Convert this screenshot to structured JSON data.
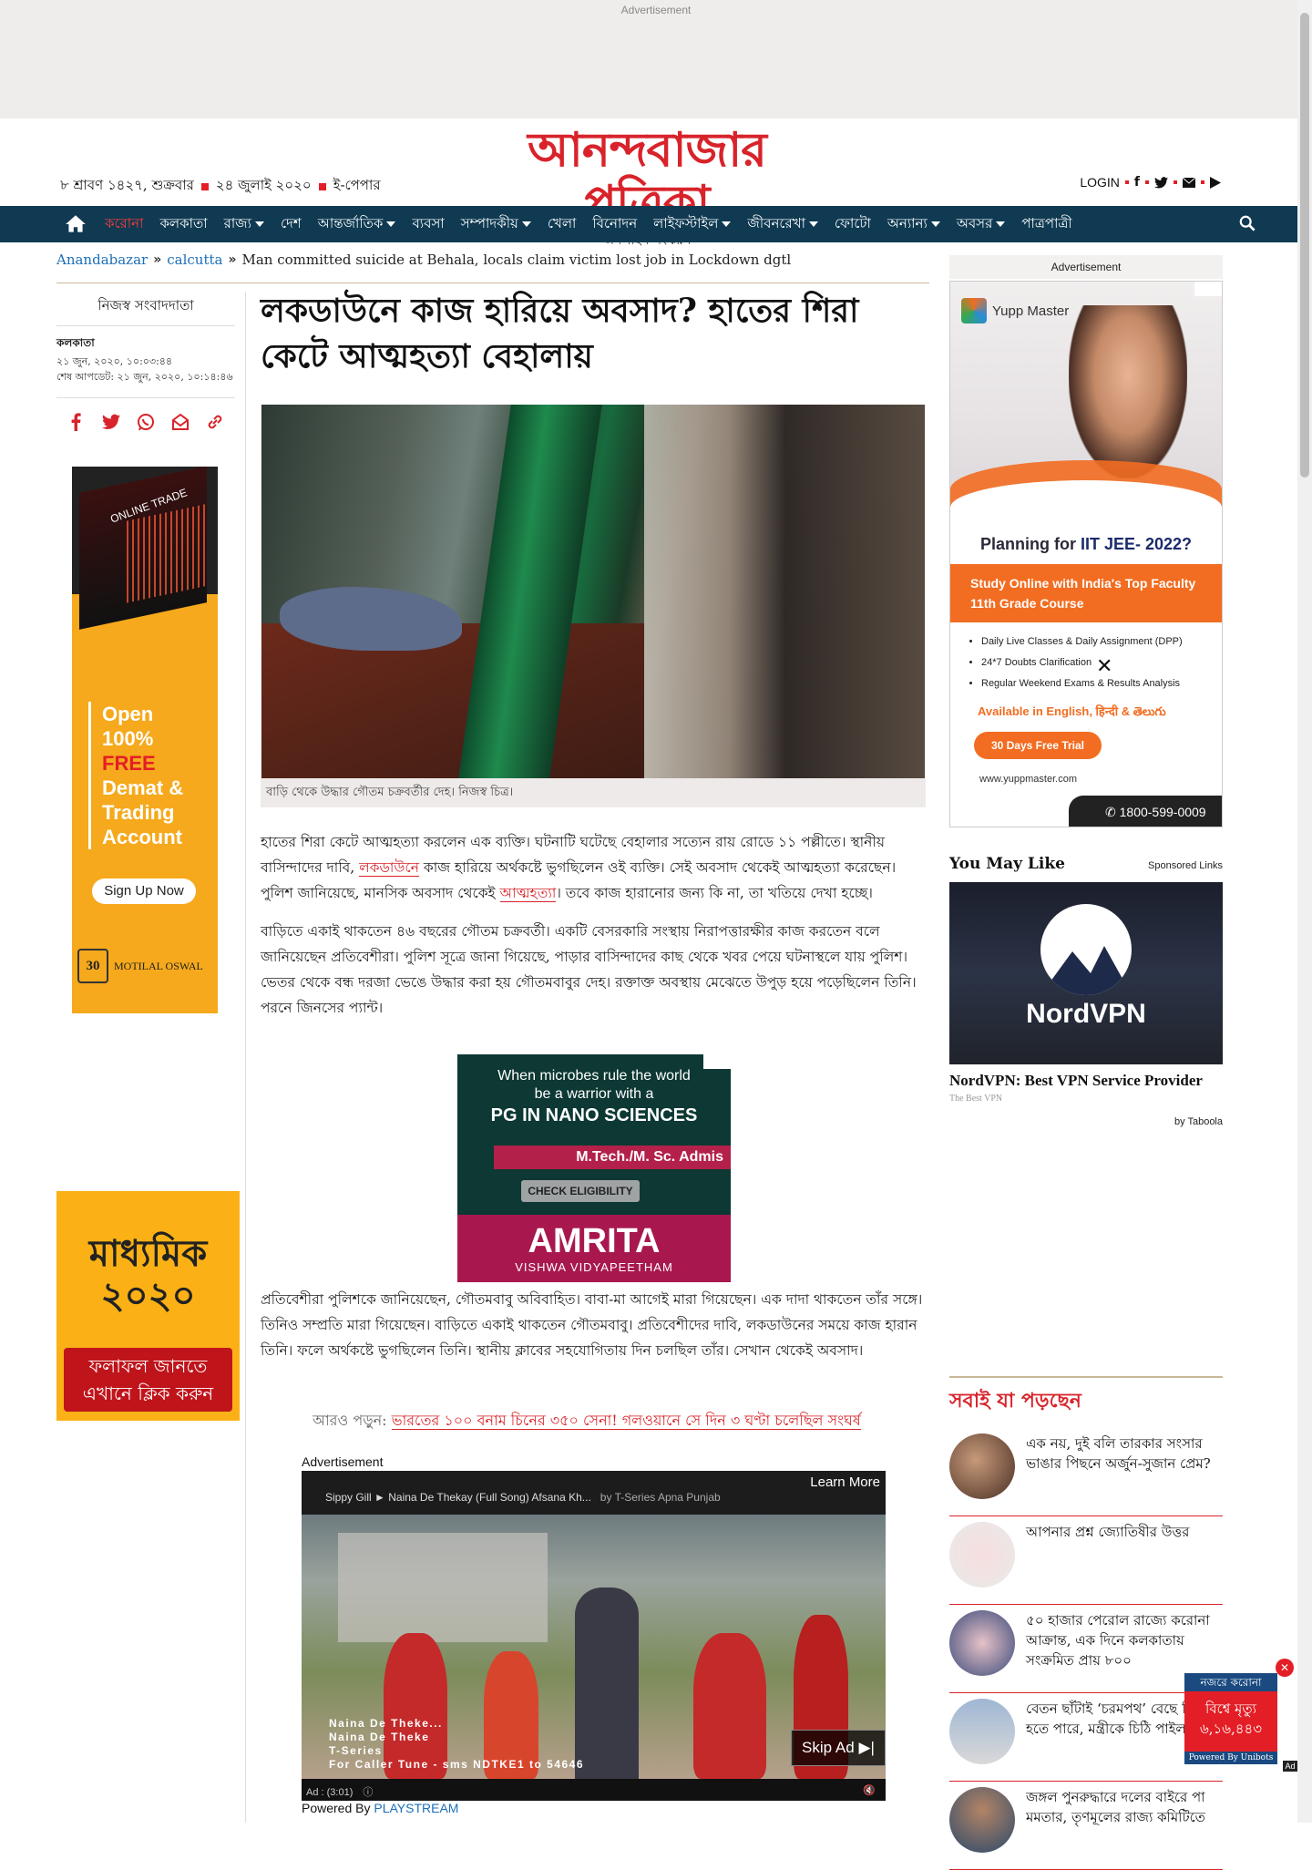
{
  "ads": {
    "top_label": "Advertisement",
    "right_label": "Advertisement",
    "video_label": "Advertisement"
  },
  "header": {
    "date_bn": "৮ শ্রাবণ ১৪২৭, শুক্রবার",
    "date_en_bn": "২৪ জুলাই ২০২০",
    "epaper": "ই-পেপার",
    "logo": "আনন্দবাজার পত্রিকা",
    "logo_sub": "অনলাইন সংস্করণ",
    "login": "LOGIN"
  },
  "nav": {
    "items": [
      {
        "label": "করোনা",
        "red": true
      },
      {
        "label": "কলকাতা"
      },
      {
        "label": "রাজ্য",
        "dropdown": true
      },
      {
        "label": "দেশ"
      },
      {
        "label": "আন্তর্জাতিক",
        "dropdown": true
      },
      {
        "label": "ব্যবসা"
      },
      {
        "label": "সম্পাদকীয়",
        "dropdown": true
      },
      {
        "label": "খেলা"
      },
      {
        "label": "বিনোদন"
      },
      {
        "label": "লাইফস্টাইল",
        "dropdown": true
      },
      {
        "label": "জীবনরেখা",
        "dropdown": true
      },
      {
        "label": "ফোটো"
      },
      {
        "label": "অন্যান্য",
        "dropdown": true
      },
      {
        "label": "অবসর",
        "dropdown": true
      },
      {
        "label": "পাত্রপাত্রী"
      }
    ]
  },
  "breadcrumb": {
    "home": "Anandabazar",
    "section": "calcutta",
    "current": "Man committed suicide at Behala, locals claim victim lost job in Lockdown dgtl"
  },
  "byline": {
    "reporter": "নিজস্ব সংবাদদাতা",
    "place": "কলকাতা",
    "published": "২১ জুন, ২০২০, ১০:০৩:৪৪",
    "updated": "শেষ আপডেট: ২১ জুন, ২০২০, ১০:১৪:৪৬"
  },
  "article": {
    "title": "লকডাউনে কাজ হারিয়ে অবসাদ? হাতের শিরা কেটে আত্মহত্যা বেহালায়",
    "caption": "বাড়ি থেকে উদ্ধার গৌতম চক্রবর্তীর দেহ। নিজস্ব চিত্র।",
    "p1_a": "হাতের শিরা কেটে আত্মহত্যা করলেন এক ব্যক্তি। ঘটনাটি ঘটেছে বেহালার সত্যেন রায় রোডে ১১ পল্লীতে। স্থানীয় বাসিন্দাদের দাবি, ",
    "p1_link1": "লকডাউনে",
    "p1_b": " কাজ হারিয়ে অর্থকষ্টে ভুগছিলেন ওই ব্যক্তি। সেই অবসাদ থেকেই আত্মহত্যা করেছেন। পুলিশ জানিয়েছে, মানসিক অবসাদ থেকেই ",
    "p1_link2": "আত্মহত্যা",
    "p1_c": "। তবে কাজ হারানোর জন্য কি না, তা খতিয়ে দেখা হচ্ছে।",
    "p2": "বাড়িতে একাই থাকতেন ৪৬ বছরের গৌতম চক্রবর্তী। একটি বেসরকারি সংস্থায় নিরাপত্তারক্ষীর কাজ করতেন বলে জানিয়েছেন প্রতিবেশীরা। পুলিশ সূত্রে জানা গিয়েছে, পাড়ার বাসিন্দাদের কাছ থেকে খবর পেয়ে ঘটনাস্থলে যায় পুলিশ। ভেতর থেকে বন্ধ দরজা ভেঙে উদ্ধার করা হয় গৌতমবাবুর দেহ। রক্তাক্ত অবস্থায় মেঝেতে উপুড় হয়ে পড়েছিলেন তিনি। পরনে জিনসের প্যান্ট।",
    "p3": "প্রতিবেশীরা পুলিশকে জানিয়েছেন, গৌতমবাবু অবিবাহিত। বাবা-মা আগেই মারা গিয়েছেন। এক দাদা থাকতেন তাঁর সঙ্গে। তিনিও সম্প্রতি মারা গিয়েছেন। বাড়িতে একাই থাকতেন গৌতমবাবু। প্রতিবেশীদের দাবি, লকডাউনের সময়ে কাজ হারান তিনি। ফলে অর্থকষ্টে ভুগছিলেন তিনি। স্থানীয় ক্লাবের সহযোগিতায় দিন চলছিল তাঁর। সেখান থেকেই অবসাদ।",
    "readmore_prefix": "আরও পড়ুন:",
    "readmore_link": "ভারতের ১০০ বনাম চিনের ৩৫০ সেনা! গলওয়ানে সে দিন ৩ ঘণ্টা চলেছিল সংঘর্ষ"
  },
  "ad_motilal": {
    "trade": "ONLINE TRADE",
    "line1": "Open",
    "line2": "100%",
    "line3": "FREE",
    "line4": "Demat &",
    "line5": "Trading",
    "line6": "Account",
    "cta": "Sign Up Now",
    "years": "30",
    "brand": "MOTILAL OSWAL"
  },
  "ad_madhyamik": {
    "title1": "মাধ্যমিক",
    "title2": "২০২০",
    "cta1": "ফলাফল জানতে",
    "cta2": "এখানে ক্লিক করুন"
  },
  "ad_amrita": {
    "l1": "When microbes rule the world",
    "l2": "be a warrior with a",
    "l3": "PG IN NANO SCIENCES",
    "pink": "M.Tech./M. Sc. Admis",
    "check": "CHECK ELIGIBILITY",
    "brand": "AMRITA",
    "sub": "VISHWA VIDYAPEETHAM"
  },
  "ad_yupp": {
    "brand": "Yupp Master",
    "plan_pre": "Planning for ",
    "plan_b": "IIT JEE- 2022?",
    "orange1": "Study Online with India's Top Faculty",
    "orange2": "11th Grade Course",
    "bullets": [
      "Daily Live Classes & Daily Assignment (DPP)",
      "24*7 Doubts Clarification",
      "Regular Weekend Exams & Results Analysis"
    ],
    "avail": "Available in English, हिन्दी & తెలుగు",
    "trial": "30 Days Free Trial",
    "url": "www.yuppmaster.com",
    "phone": "1800-599-0009"
  },
  "you_may_like": {
    "heading": "You May Like",
    "sponsored": "Sponsored Links",
    "brand": "NordVPN",
    "title": "NordVPN: Best VPN Service Provider",
    "source": "The Best VPN",
    "by": "by Taboola"
  },
  "video": {
    "title": "Sippy Gill ► Naina De Thekay (Full Song) Afsana Kh...",
    "by": "by T-Series Apna Punjab",
    "learn_more": "Learn More",
    "credit1": "Naina De Theke...",
    "credit2": "Naina De Theke",
    "credit3": "T-Series",
    "credit4": "For Caller Tune - sms NDTKE1 to 54646",
    "skip": "Skip Ad",
    "ad_time": "Ad : (3:01)",
    "powered_pre": "Powered By ",
    "powered": "PLAYSTREAM"
  },
  "popular": {
    "heading": "সবাই যা পড়ছেন",
    "items": [
      {
        "text": "এক নয়, দুই বলি তারকার সংসার ভাঙার পিছনে অর্জুন-সুজান প্রেম?"
      },
      {
        "text": "আপনার প্রশ্ন জ্যোতিষীর উত্তর"
      },
      {
        "text": "৫০ হাজার পেরোল রাজ্যে করোনা আক্রান্ত, এক দিনে কলকাতায় সংক্রমিত প্রায় ৮০০"
      },
      {
        "text": "বেতন ছাঁটাই ‘চরমপথ’ বেছে নিতে হতে পারে, মন্ত্রীকে চিঠি পাইলটদের"
      },
      {
        "text": "জঙ্গল পুনরুদ্ধারে দলের বাইরে পা মমতার, তৃণমূলের রাজ্য কমিটিতে"
      }
    ]
  },
  "corona_widget": {
    "top": "নজরে করোনা",
    "label": "বিশ্বে মৃত্যু",
    "count": "৬,১৬,৪৪৩",
    "bottom": "Powered By Unibots",
    "ad": "Ad"
  }
}
